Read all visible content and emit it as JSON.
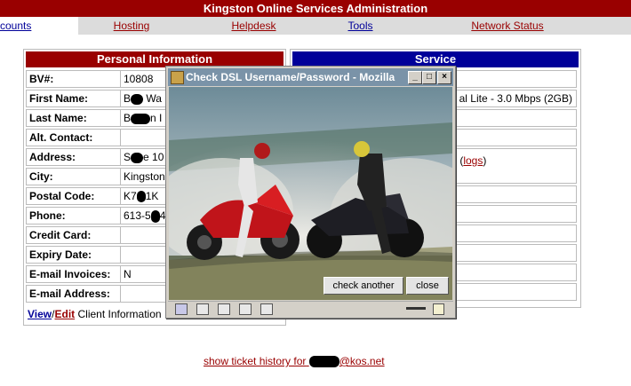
{
  "header": {
    "title": "Kingston Online Services Administration"
  },
  "nav": [
    {
      "label": "counts"
    },
    {
      "label": "Hosting"
    },
    {
      "label": "Helpdesk"
    },
    {
      "label": "Tools"
    },
    {
      "label": "Network Status"
    }
  ],
  "personal": {
    "title": "Personal Information",
    "fields": [
      {
        "label": "BV#:",
        "value": "10808"
      },
      {
        "label": "First Name:",
        "value_a": "B",
        "value_b": "Wa"
      },
      {
        "label": "Last Name:",
        "value_a": "B",
        "value_b": "n I"
      },
      {
        "label": "Alt. Contact:",
        "value": ""
      },
      {
        "label": "Address:",
        "value_a": "S",
        "value_b": "e 10"
      },
      {
        "label": "City:",
        "value": "Kingston"
      },
      {
        "label": "Postal Code:",
        "value_a": "K7",
        "value_b": "1K"
      },
      {
        "label": "Phone:",
        "value_a": "613-5",
        "value_b": "4-"
      },
      {
        "label": "Credit Card:",
        "value": ""
      },
      {
        "label": "Expiry Date:",
        "value": ""
      },
      {
        "label": "E-mail Invoices:",
        "value": "N"
      },
      {
        "label": "E-mail Address:",
        "value": ""
      }
    ],
    "view_link": "View",
    "separator": "/",
    "edit_link": "Edit",
    "footer_text": "Client Information"
  },
  "service": {
    "title": "Service",
    "plan_text": "al Lite - 3.0 Mbps (2GB)",
    "status_text": ") (",
    "logs_link": "logs",
    "status_close": ")"
  },
  "popup": {
    "title": "Check DSL Username/Password - Mozilla",
    "check_another": "check another",
    "close": "close"
  },
  "ticket": {
    "prefix": "show ticket history for",
    "suffix": "@kos.net"
  },
  "colors": {
    "header": "#990000",
    "service_header": "#000099",
    "link": "#990000"
  }
}
